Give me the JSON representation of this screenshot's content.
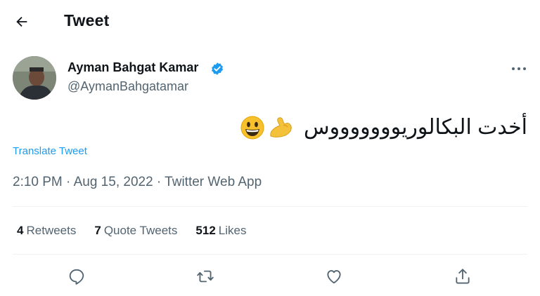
{
  "header": {
    "title": "Tweet"
  },
  "tweet": {
    "author_name": "Ayman Bahgat Kamar",
    "handle": "@AymanBahgatamar",
    "text": "أخدت البكالوريوووووووس",
    "emojis": [
      "grinning-face",
      "flexed-biceps"
    ],
    "translate_label": "Translate Tweet",
    "meta": "2:10 PM · Aug 15, 2022 · Twitter Web App"
  },
  "stats": {
    "retweets_count": "4",
    "retweets_label": "Retweets",
    "quotes_count": "7",
    "quotes_label": "Quote Tweets",
    "likes_count": "512",
    "likes_label": "Likes"
  },
  "colors": {
    "accent": "#1d9bf0",
    "text": "#0f1419",
    "muted": "#536471",
    "divider": "#eff3f4"
  },
  "icons": [
    "back-arrow-icon",
    "verified-badge-icon",
    "more-icon",
    "reply-icon",
    "retweet-icon",
    "like-icon",
    "share-icon"
  ]
}
